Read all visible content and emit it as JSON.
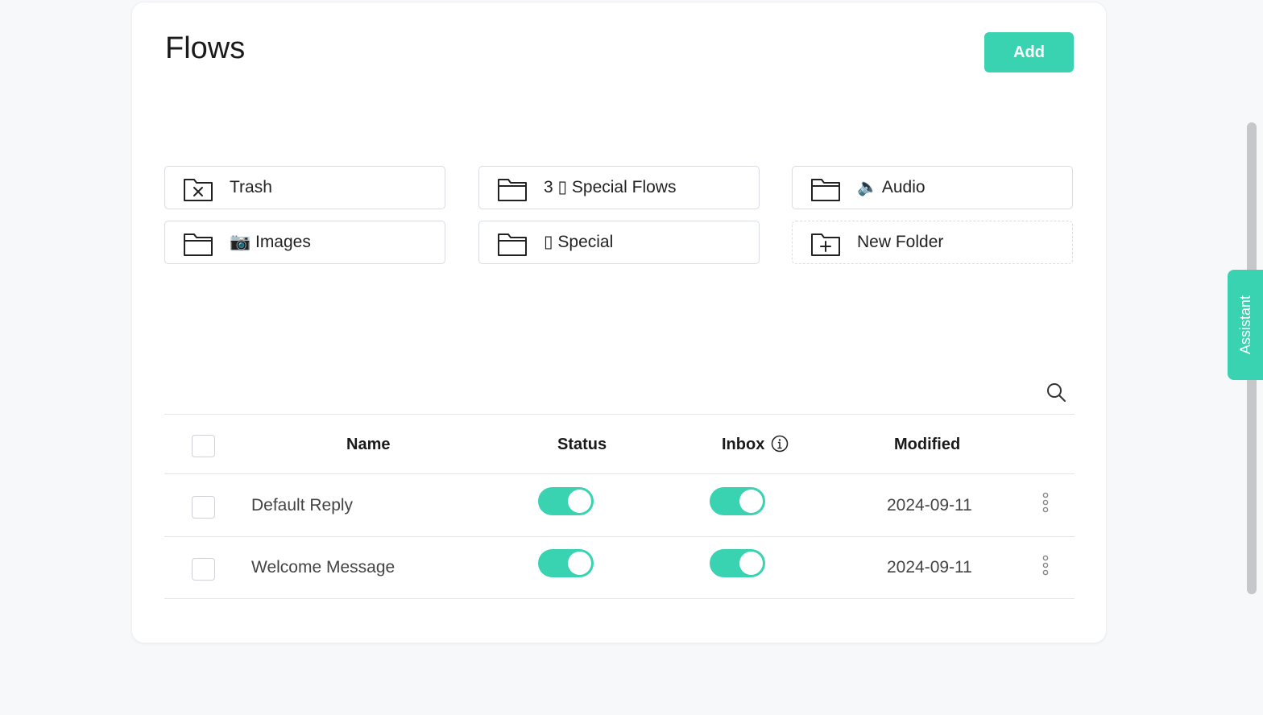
{
  "page": {
    "title": "Flows"
  },
  "toolbar": {
    "add_label": "Add"
  },
  "folders": [
    {
      "label": "Trash",
      "icon": "folder-x-icon"
    },
    {
      "label": "3 ▯ Special Flows",
      "icon": "folder-icon"
    },
    {
      "label": "🔈 Audio",
      "icon": "folder-icon"
    },
    {
      "label": "📷 Images",
      "icon": "folder-icon"
    },
    {
      "label": "▯ Special",
      "icon": "folder-icon"
    },
    {
      "label": "New Folder",
      "icon": "folder-plus-icon"
    }
  ],
  "table": {
    "headers": {
      "name": "Name",
      "status": "Status",
      "inbox": "Inbox",
      "modified": "Modified"
    },
    "rows": [
      {
        "name": "Default Reply",
        "status": true,
        "inbox": true,
        "modified": "2024-09-11"
      },
      {
        "name": "Welcome Message",
        "status": true,
        "inbox": true,
        "modified": "2024-09-11"
      }
    ]
  },
  "assistant": {
    "label": "Assistant"
  },
  "colors": {
    "accent": "#39d3b2",
    "border": "#d9dce1",
    "background": "#f7f8fa"
  }
}
